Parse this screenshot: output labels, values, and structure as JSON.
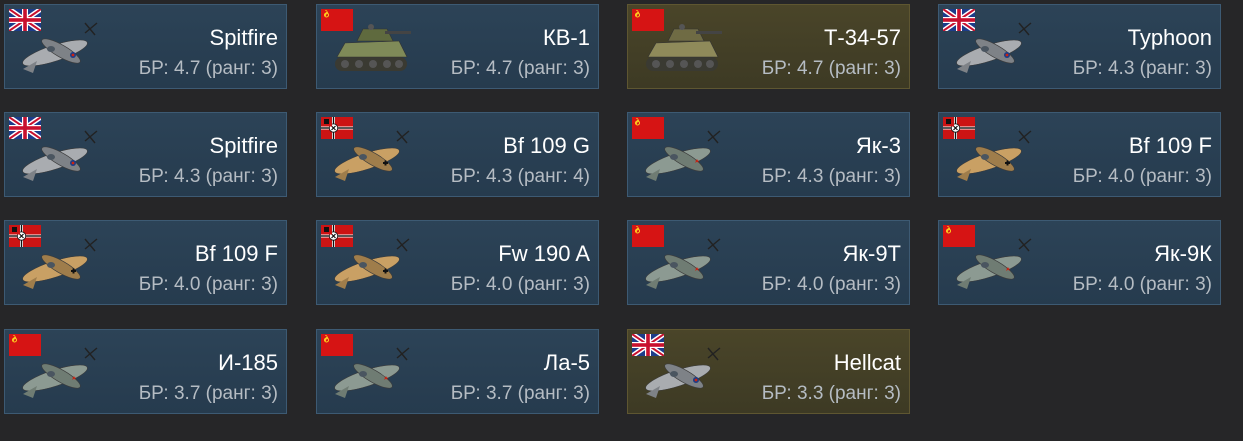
{
  "colors": {
    "background": "#262628",
    "card": "#2c4357",
    "card_border": "#3d5a73",
    "premium_card": "#4a4529",
    "premium_border": "#5e5631",
    "name_text": "#ffffff",
    "br_text": "#b5bcc3"
  },
  "vehicles": [
    {
      "name": "Spitfire",
      "br": "БР: 4.7 (ранг: 3)",
      "nation": "uk",
      "flag_icon": "uk-flag-icon",
      "type": "aircraft",
      "image_icon": "spitfire-aircraft-icon",
      "premium": false
    },
    {
      "name": "КВ-1",
      "br": "БР: 4.7 (ранг: 3)",
      "nation": "ussr",
      "flag_icon": "ussr-flag-icon",
      "type": "tank",
      "image_icon": "kv-1-tank-icon",
      "premium": false
    },
    {
      "name": "Т-34-57",
      "br": "БР: 4.7 (ранг: 3)",
      "nation": "ussr",
      "flag_icon": "ussr-flag-icon",
      "type": "tank",
      "image_icon": "t-34-57-tank-icon",
      "premium": true
    },
    {
      "name": "Typhoon",
      "br": "БР: 4.3 (ранг: 3)",
      "nation": "uk",
      "flag_icon": "uk-flag-icon",
      "type": "aircraft",
      "image_icon": "typhoon-aircraft-icon",
      "premium": false
    },
    {
      "name": "Spitfire",
      "br": "БР: 4.3 (ранг: 3)",
      "nation": "uk",
      "flag_icon": "uk-flag-icon",
      "type": "aircraft",
      "image_icon": "spitfire-aircraft-icon",
      "premium": false
    },
    {
      "name": "Bf 109 G",
      "br": "БР: 4.3 (ранг: 4)",
      "nation": "germany",
      "flag_icon": "germany-flag-icon",
      "type": "aircraft",
      "image_icon": "bf-109-g-aircraft-icon",
      "premium": false
    },
    {
      "name": "Як-3",
      "br": "БР: 4.3 (ранг: 3)",
      "nation": "ussr",
      "flag_icon": "ussr-flag-icon",
      "type": "aircraft",
      "image_icon": "yak-3-aircraft-icon",
      "premium": false
    },
    {
      "name": "Bf 109 F",
      "br": "БР: 4.0 (ранг: 3)",
      "nation": "germany",
      "flag_icon": "germany-flag-icon",
      "type": "aircraft",
      "image_icon": "bf-109-f-aircraft-icon",
      "premium": false
    },
    {
      "name": "Bf 109 F",
      "br": "БР: 4.0 (ранг: 3)",
      "nation": "germany",
      "flag_icon": "germany-flag-icon",
      "type": "aircraft",
      "image_icon": "bf-109-f-aircraft-icon",
      "premium": false
    },
    {
      "name": "Fw 190 A",
      "br": "БР: 4.0 (ранг: 3)",
      "nation": "germany",
      "flag_icon": "germany-flag-icon",
      "type": "aircraft",
      "image_icon": "fw-190-a-aircraft-icon",
      "premium": false
    },
    {
      "name": "Як-9Т",
      "br": "БР: 4.0 (ранг: 3)",
      "nation": "ussr",
      "flag_icon": "ussr-flag-icon",
      "type": "aircraft",
      "image_icon": "yak-9t-aircraft-icon",
      "premium": false
    },
    {
      "name": "Як-9К",
      "br": "БР: 4.0 (ранг: 3)",
      "nation": "ussr",
      "flag_icon": "ussr-flag-icon",
      "type": "aircraft",
      "image_icon": "yak-9k-aircraft-icon",
      "premium": false
    },
    {
      "name": "И-185",
      "br": "БР: 3.7 (ранг: 3)",
      "nation": "ussr",
      "flag_icon": "ussr-flag-icon",
      "type": "aircraft",
      "image_icon": "i-185-aircraft-icon",
      "premium": false
    },
    {
      "name": "Ла-5",
      "br": "БР: 3.7 (ранг: 3)",
      "nation": "ussr",
      "flag_icon": "ussr-flag-icon",
      "type": "aircraft",
      "image_icon": "la-5-aircraft-icon",
      "premium": false
    },
    {
      "name": "Hellcat",
      "br": "БР: 3.3 (ранг: 3)",
      "nation": "uk",
      "flag_icon": "uk-flag-icon",
      "type": "aircraft",
      "image_icon": "hellcat-aircraft-icon",
      "premium": true
    }
  ]
}
